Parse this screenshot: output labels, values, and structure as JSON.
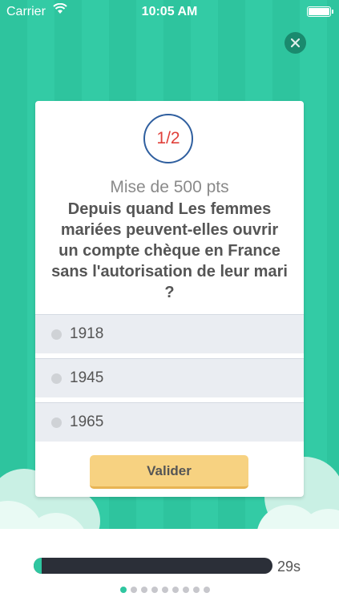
{
  "status_bar": {
    "carrier": "Carrier",
    "time": "10:05 AM"
  },
  "quiz": {
    "progress": "1/2",
    "stake": "Mise de 500 pts",
    "question": "Depuis quand Les femmes mariées peuvent-elles ouvrir un compte chèque en France sans l'autorisation de leur mari ?",
    "answers": [
      {
        "label": "1918"
      },
      {
        "label": "1945"
      },
      {
        "label": "1965"
      }
    ],
    "validate_label": "Valider"
  },
  "timer": {
    "label": "29s",
    "fraction_remaining": 0.03
  },
  "pager": {
    "count": 9,
    "active_index": 0
  },
  "colors": {
    "accent": "#2fc6a0",
    "badge_text": "#e0403a",
    "badge_border": "#2f5f9f",
    "button": "#f7d281"
  }
}
